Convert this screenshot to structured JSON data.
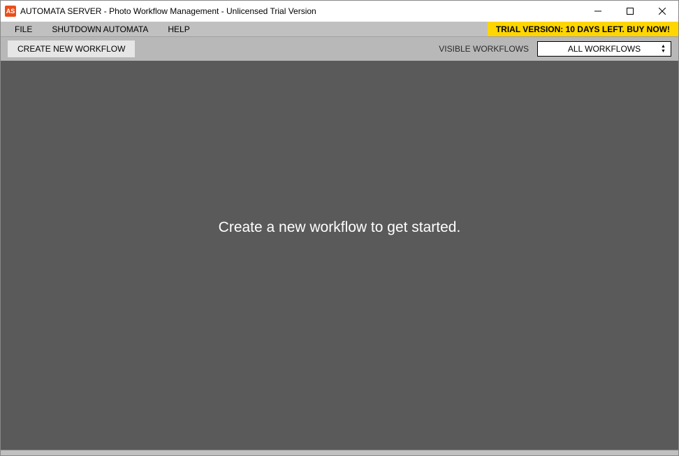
{
  "titlebar": {
    "icon_text": "AS",
    "title": "AUTOMATA SERVER - Photo Workflow Management - Unlicensed Trial Version"
  },
  "menubar": {
    "file": "FILE",
    "shutdown": "SHUTDOWN AUTOMATA",
    "help": "HELP",
    "trial_banner": "TRIAL VERSION: 10 DAYS LEFT. BUY NOW!"
  },
  "toolbar": {
    "create_label": "CREATE NEW WORKFLOW",
    "visible_label": "VISIBLE WORKFLOWS",
    "select_value": "ALL WORKFLOWS"
  },
  "content": {
    "placeholder": "Create a new workflow to get started."
  }
}
